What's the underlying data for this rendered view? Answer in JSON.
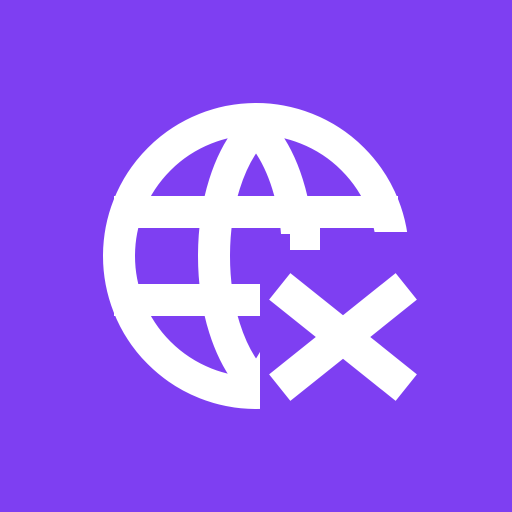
{
  "icon": {
    "name": "globe-off-icon",
    "background_color": "#7E3FF2",
    "glyph_color": "#FFFFFF"
  }
}
